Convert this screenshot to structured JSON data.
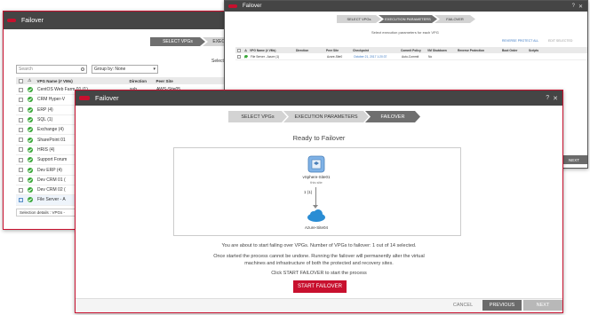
{
  "windows": {
    "back_left": {
      "title": "Failover",
      "steps": [
        "SELECT VPGs",
        "EXECU"
      ],
      "select_label": "Select",
      "search_placeholder": "Search",
      "group_by": "Group by: None",
      "columns": [
        "VPG Name (# VMs)",
        "Direction",
        "Peer Site"
      ],
      "rows": [
        {
          "name": "CentOS Web Farm 01 (1)",
          "direction": "sub",
          "peer": "AWS-Site05",
          "checked": false
        },
        {
          "name": "CRM Hyper-V",
          "direction": "",
          "peer": "",
          "checked": false
        },
        {
          "name": "ERP (4)",
          "direction": "",
          "peer": "",
          "checked": false
        },
        {
          "name": "SQL (1)",
          "direction": "",
          "peer": "",
          "checked": false
        },
        {
          "name": "Exchange (4)",
          "direction": "",
          "peer": "",
          "checked": false
        },
        {
          "name": "SharePoint 01",
          "direction": "",
          "peer": "",
          "checked": false
        },
        {
          "name": "HRIS (4)",
          "direction": "",
          "peer": "",
          "checked": false
        },
        {
          "name": "Support Forum",
          "direction": "",
          "peer": "",
          "checked": false
        },
        {
          "name": "Dev ERP (4)",
          "direction": "",
          "peer": "",
          "checked": false
        },
        {
          "name": "Dev CRM 01 (",
          "direction": "",
          "peer": "",
          "checked": false
        },
        {
          "name": "Dev CRM 02 (",
          "direction": "",
          "peer": "",
          "checked": false
        },
        {
          "name": "File Server - A",
          "direction": "",
          "peer": "",
          "checked": true
        }
      ],
      "selection_details": "Selection details : VPGs -"
    },
    "back_right": {
      "title": "Failover",
      "steps": [
        "SELECT VPGs",
        "EXECUTION PARAMETERS",
        "FAILOVER"
      ],
      "subtitle": "Select execution parameters for each VPG",
      "links": [
        "REVERSE PROTECT ALL",
        "EDIT SELECTED"
      ],
      "columns": [
        "VPG Name (# VMs)",
        "Direction",
        "Peer Site",
        "Checkpoint",
        "Commit Policy",
        "VM Shutdown",
        "Reverse Protection",
        "Boot Order",
        "Scripts"
      ],
      "row": {
        "name": "File Server - Azure (1)",
        "direction": "",
        "peer": "Azure-Site0",
        "checkpoint": "October 21, 2017 1:20:37",
        "commit": "Auto-Commit",
        "shutdown": "No"
      },
      "next_button": "NEXT"
    },
    "front": {
      "title": "Failover",
      "steps": [
        "SELECT VPGs",
        "EXECUTION PARAMETERS",
        "FAILOVER"
      ],
      "heading": "Ready to Failover",
      "source_site": "vSphere-Site01",
      "source_subtitle": "this site",
      "vm_count": "1 (1)",
      "target_site": "Azure-Site04",
      "info_line1": "You are about to start failing over VPGs. Number of VPGs to failover: 1 out of 14 selected.",
      "info_line2": "Once started the process cannot be undone. Running the failover will permanently alter the virtual",
      "info_line3": "machines and infrastructure of both the protected and recovery sites.",
      "info_line4": "Click START FAILOVER to start the process",
      "start_button": "START FAILOVER",
      "cancel_button": "CANCEL",
      "previous_button": "PREVIOUS",
      "next_button": "NEXT"
    }
  },
  "colors": {
    "accent": "#c8102e",
    "titlebar": "#454545",
    "success": "#3aa83a",
    "footer": "#6b6b6b"
  }
}
